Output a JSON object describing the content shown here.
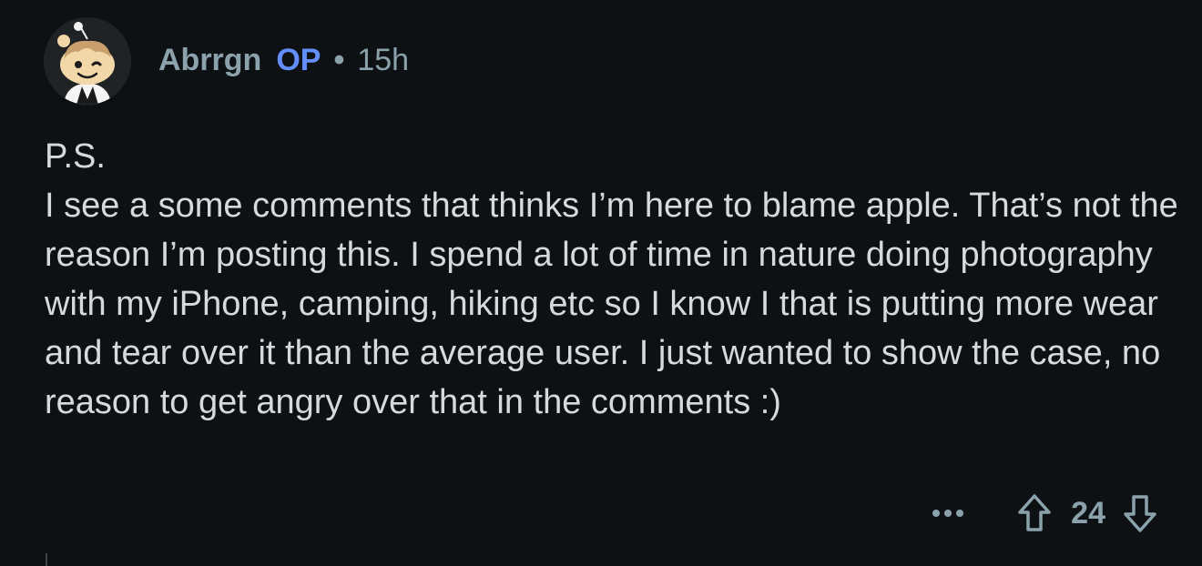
{
  "comment": {
    "author": "Abrrgn",
    "op_badge": "OP",
    "separator": "•",
    "time": "15h",
    "body_lines": [
      "P.S.",
      "I see a some comments that thinks I’m here to blame apple. That’s not the reason I’m posting this. I spend a lot of time in nature doing photography with my iPhone, camping, hiking etc so I know I that is putting more wear and tear over it than the average user. I just wanted to show the case, no reason to get angry over that in the comments :)"
    ],
    "score": "24"
  },
  "icons": {
    "avatar": "snoo-avatar",
    "more": "more-options-icon",
    "upvote": "upvote-arrow-icon",
    "downvote": "downvote-arrow-icon"
  },
  "colors": {
    "background": "#0e1113",
    "text": "#d7dadc",
    "meta": "#8ba2ad",
    "op_badge": "#648efc"
  }
}
